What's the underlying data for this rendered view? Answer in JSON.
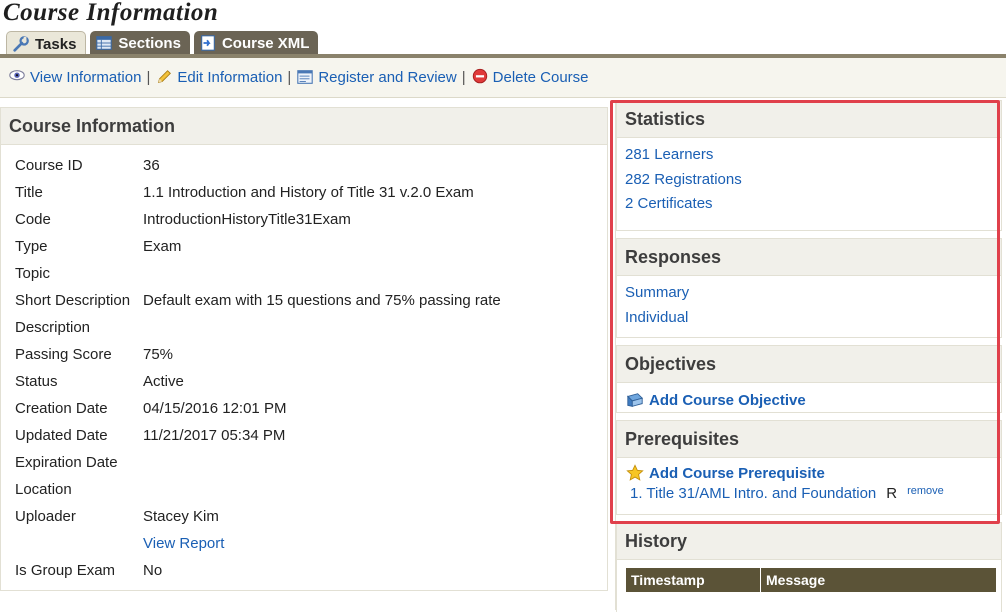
{
  "page": {
    "title": "Course Information"
  },
  "tabs": [
    {
      "label": "Tasks",
      "icon": "wrench-icon"
    },
    {
      "label": "Sections",
      "icon": "table-icon"
    },
    {
      "label": "Course XML",
      "icon": "xml-icon"
    }
  ],
  "toolbar": {
    "view": "View Information",
    "edit": "Edit Information",
    "register": "Register and Review",
    "delete": "Delete Course",
    "separator": "|"
  },
  "course_info": {
    "heading": "Course Information",
    "rows": [
      {
        "label": "Course ID",
        "value": "36"
      },
      {
        "label": "Title",
        "value": "1.1 Introduction and History of Title 31 v.2.0 Exam"
      },
      {
        "label": "Code",
        "value": "IntroductionHistoryTitle31Exam"
      },
      {
        "label": "Type",
        "value": "Exam"
      },
      {
        "label": "Topic",
        "value": ""
      },
      {
        "label": "Short Description",
        "value": "Default exam with 15 questions and 75% passing rate"
      },
      {
        "label": "Description",
        "value": ""
      },
      {
        "label": "Passing Score",
        "value": "75%"
      },
      {
        "label": "Status",
        "value": "Active"
      },
      {
        "label": "Creation Date",
        "value": "04/15/2016 12:01 PM"
      },
      {
        "label": "Updated Date",
        "value": "11/21/2017 05:34 PM"
      },
      {
        "label": "Expiration Date",
        "value": ""
      },
      {
        "label": "Location",
        "value": ""
      },
      {
        "label": "Uploader",
        "value": "Stacey Kim"
      },
      {
        "label": "",
        "value": "View Report"
      },
      {
        "label": "Is Group Exam",
        "value": "No"
      }
    ]
  },
  "statistics": {
    "heading": "Statistics",
    "learners": "281 Learners",
    "registrations": "282 Registrations",
    "certificates": "2 Certificates"
  },
  "responses": {
    "heading": "Responses",
    "summary": "Summary",
    "individual": "Individual"
  },
  "objectives": {
    "heading": "Objectives",
    "add": "Add Course Objective"
  },
  "prerequisites": {
    "heading": "Prerequisites",
    "add": "Add Course Prerequisite",
    "item": "1. Title 31/AML Intro. and Foundation",
    "required_flag": "R",
    "remove": "remove"
  },
  "history": {
    "heading": "History",
    "columns": [
      "Timestamp",
      "Message"
    ]
  },
  "colors": {
    "highlight": "#e0404b",
    "link": "#1a5fb4",
    "tab_bg": "#6b6455",
    "table_header": "#5b5337"
  }
}
